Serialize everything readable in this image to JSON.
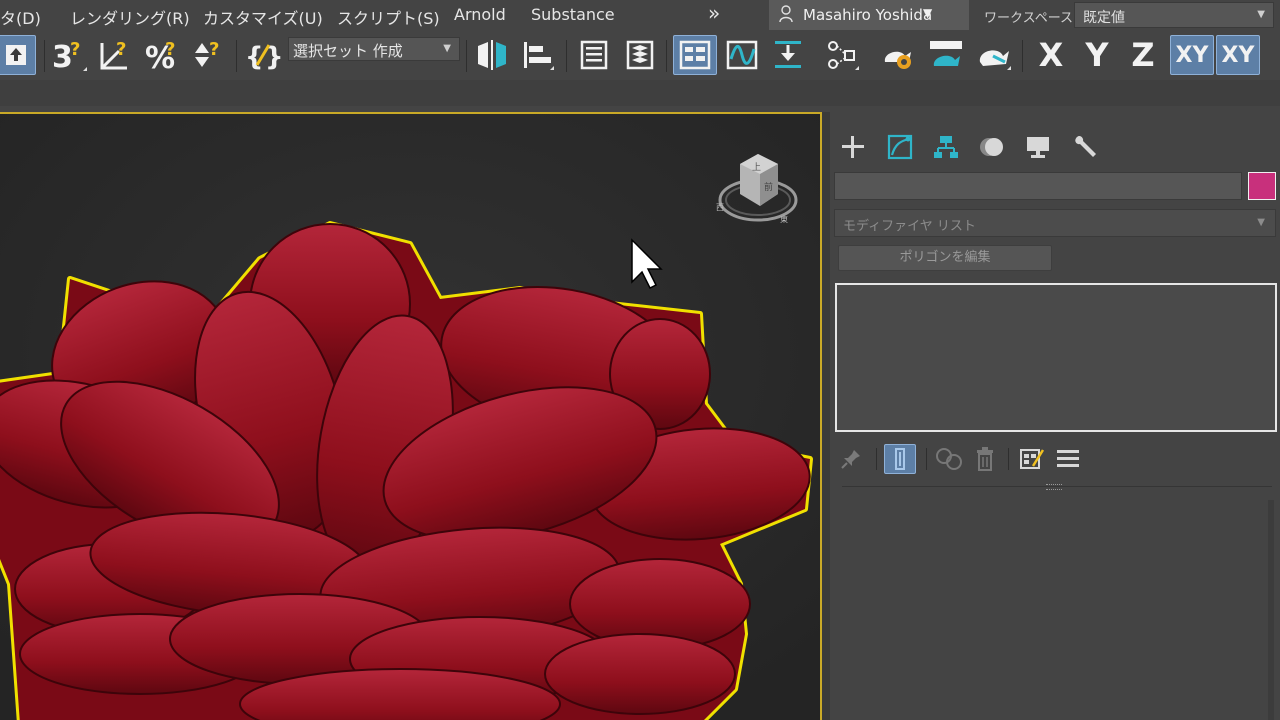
{
  "menu": {
    "items": [
      "タ(D)",
      "レンダリング(R)",
      "カスタマイズ(U)",
      "スクリプト(S)",
      "Arnold",
      "Substance"
    ],
    "overflow": "»",
    "user_name": "Masahiro Yoshida",
    "workspace_label": "ワークスペース:",
    "workspace_value": "既定値"
  },
  "toolbar": {
    "selection_set_value": "選択セット 作成",
    "axis_labels": [
      "X",
      "Y",
      "Z",
      "XY",
      "XY"
    ],
    "snap_label_3": "3",
    "percent_label": "%"
  },
  "command_panel": {
    "tabs": [
      "create",
      "modify",
      "hierarchy",
      "motion",
      "display",
      "utilities"
    ],
    "object_name": "",
    "object_color": "#c8307c",
    "modifier_list_label": "モディファイヤ リスト",
    "edit_poly_button": "ポリゴンを編集",
    "stack_items": []
  },
  "viewport": {
    "viewcube_top_label": "上",
    "viewcube_front_label": "前",
    "viewcube_compass_e": "東",
    "viewcube_compass_w": "西",
    "object_color": "#8b0f1c",
    "selection_outline_color": "#f0e000"
  },
  "colors": {
    "accent_active": "#5d7fa6",
    "viewport_active_border": "#c9a927"
  }
}
